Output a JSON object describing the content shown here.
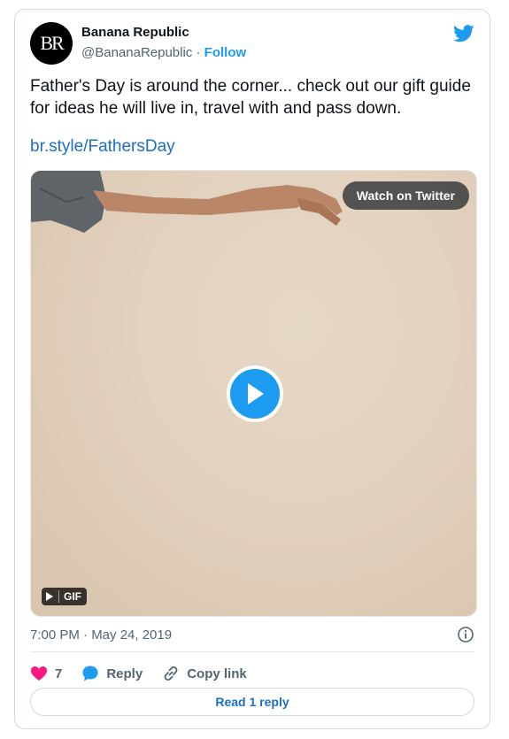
{
  "author": {
    "name": "Banana Republic",
    "handle": "@BananaRepublic",
    "separator": "·",
    "follow_label": "Follow",
    "avatar_text": "BR"
  },
  "tweet": {
    "text": "Father's Day is around the corner... check out our gift guide for ideas he will live in, travel with and pass down.",
    "link": "br.style/FathersDay",
    "timestamp": "7:00 PM · May 24, 2019"
  },
  "media": {
    "watch_label": "Watch on Twitter",
    "gif_label": "GIF"
  },
  "actions": {
    "likes_count": "7",
    "reply_label": "Reply",
    "copy_label": "Copy link",
    "read_replies_label": "Read 1 reply"
  },
  "colors": {
    "accent": "#1d9bf0",
    "link": "#1d6fc1",
    "heart": "#f91880",
    "muted": "#536471"
  },
  "icons": {
    "logo": "twitter-bird-icon",
    "play": "play-icon",
    "info": "info-icon",
    "like": "heart-icon",
    "reply": "reply-bubble-icon",
    "copy": "link-icon"
  }
}
